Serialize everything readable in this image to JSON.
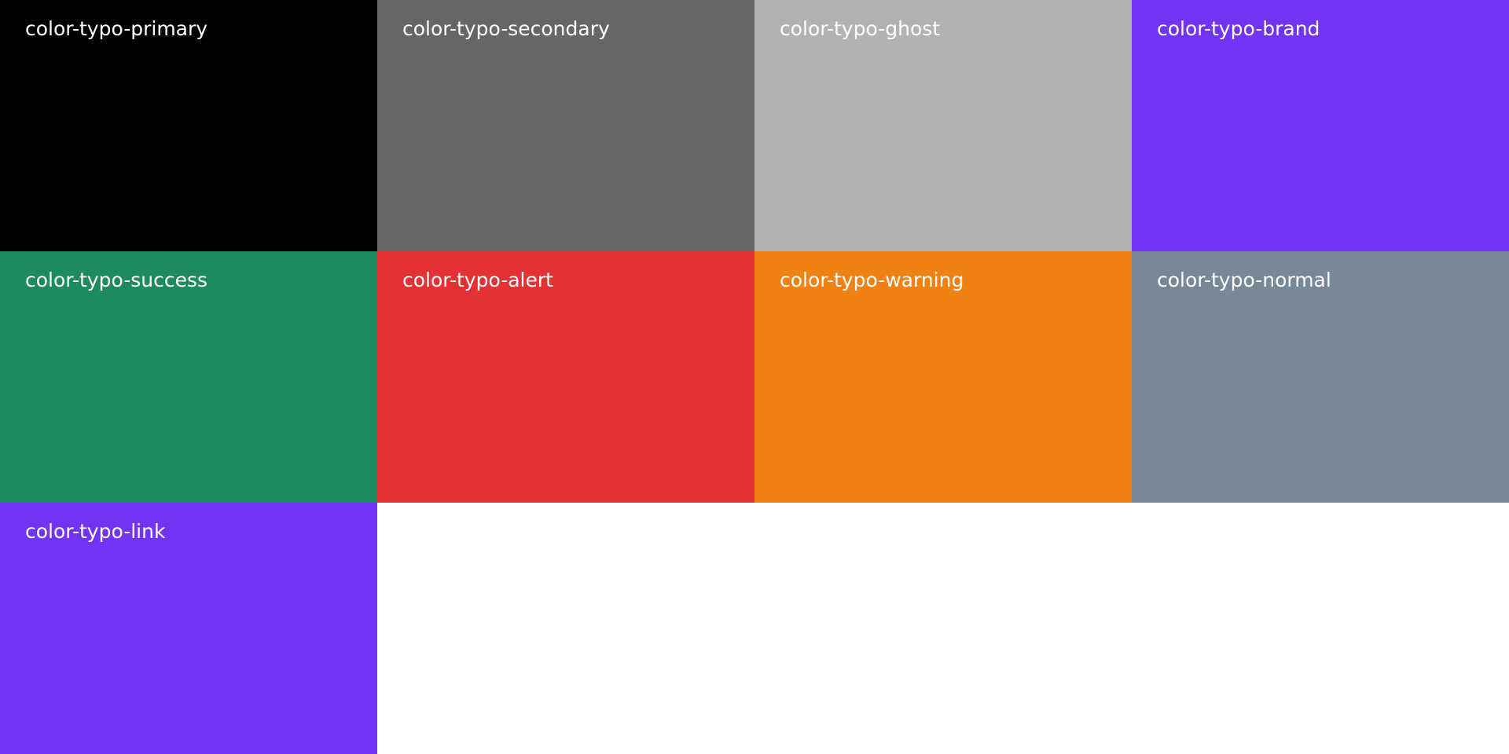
{
  "swatches": [
    {
      "label": "color-typo-primary",
      "color": "#000000"
    },
    {
      "label": "color-typo-secondary",
      "color": "#666666"
    },
    {
      "label": "color-typo-ghost",
      "color": "#b2b2b2"
    },
    {
      "label": "color-typo-brand",
      "color": "#7034f2"
    },
    {
      "label": "color-typo-success",
      "color": "#1d8a60"
    },
    {
      "label": "color-typo-alert",
      "color": "#e43133"
    },
    {
      "label": "color-typo-warning",
      "color": "#f08113"
    },
    {
      "label": "color-typo-normal",
      "color": "#778899"
    },
    {
      "label": "color-typo-link",
      "color": "#7034f2"
    }
  ],
  "label_color": "#ffffff",
  "background": "#ffffff"
}
